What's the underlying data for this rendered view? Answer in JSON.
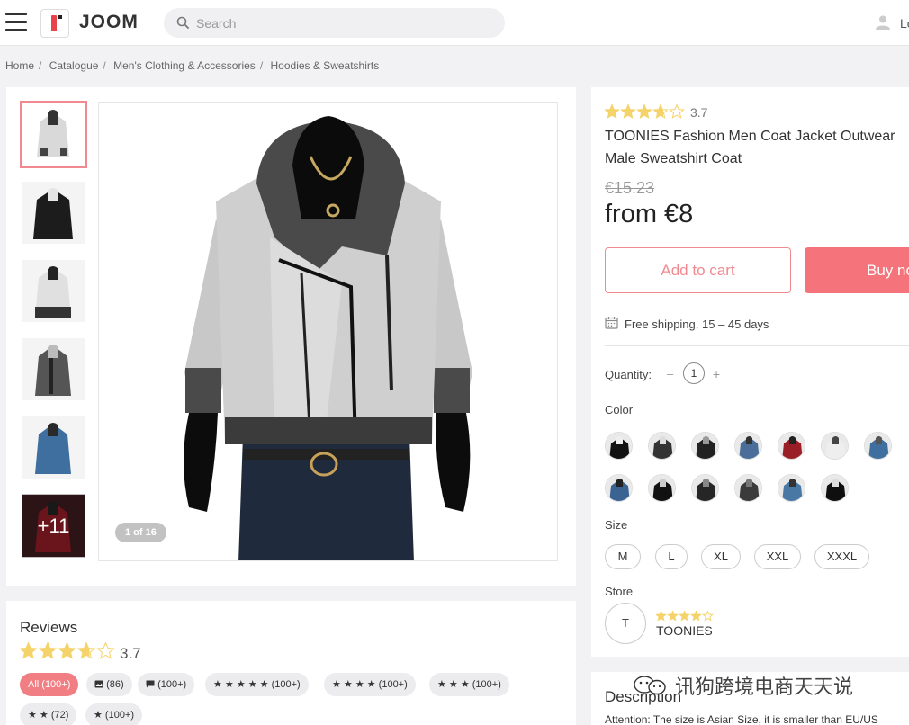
{
  "header": {
    "logo_text": "JOOM",
    "search_placeholder": "Search",
    "login_text": "Lo"
  },
  "breadcrumb": [
    "Home",
    "Catalogue",
    "Men's Clothing & Accessories",
    "Hoodies & Sweatshirts"
  ],
  "gallery": {
    "more_label": "+11",
    "counter": "1 of 16"
  },
  "product": {
    "rating": "3.7",
    "rating_value": 3.7,
    "title": "TOONIES Fashion Men Coat Jacket Outwear Male Sweatshirt Coat",
    "old_price": "€15.23",
    "price": "from €8",
    "add_to_cart": "Add to cart",
    "buy_now": "Buy now",
    "shipping": "Free shipping, 15 – 45 days",
    "quantity_label": "Quantity:",
    "quantity_minus": "–",
    "quantity_value": "1",
    "quantity_plus": "+",
    "color_label": "Color",
    "size_label": "Size",
    "sizes": [
      "M",
      "L",
      "XL",
      "XXL",
      "XXXL"
    ],
    "store_label": "Store",
    "store_initial": "T",
    "store_name": "TOONIES",
    "store_rating_value": 4
  },
  "reviews": {
    "title": "Reviews",
    "score": "3.7",
    "filters": [
      {
        "label": "All (100+)"
      },
      {
        "label": "(86)"
      },
      {
        "label": "(100+)"
      },
      {
        "label": "★ ★ ★ ★ ★ (100+)"
      },
      {
        "label": "★ ★ ★ ★ (100+)"
      },
      {
        "label": "★ ★ ★ (100+)"
      },
      {
        "label": "★ ★ (72)"
      },
      {
        "label": "★ (100+)"
      }
    ]
  },
  "description": {
    "title": "Description",
    "text": "Attention: The size is Asian Size, it is smaller than EU/US"
  },
  "watermark": "讯狗跨境电商天天说",
  "colors": {
    "accent": "#f5737a",
    "accent_light": "#f08a90",
    "star": "#f5d36b"
  }
}
